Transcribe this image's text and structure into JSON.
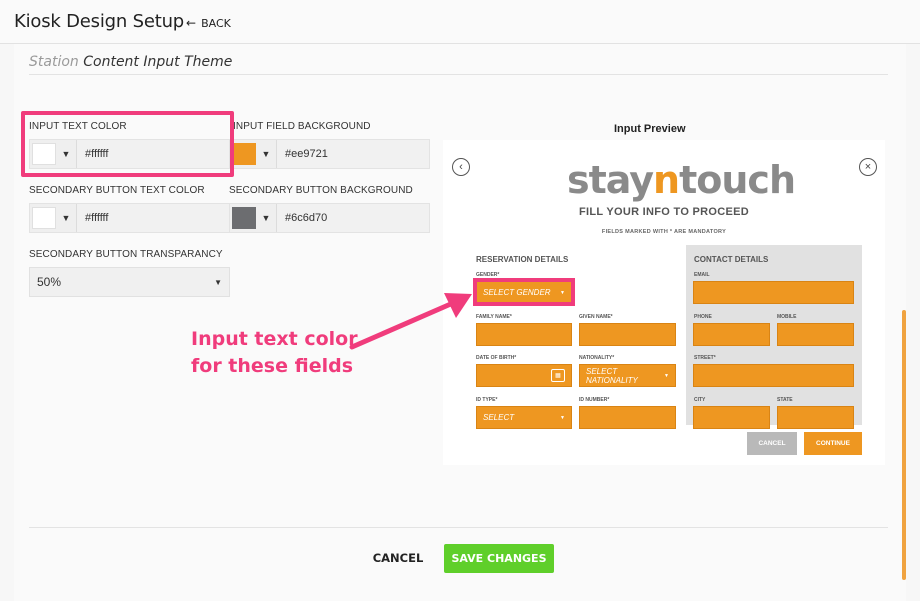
{
  "header": {
    "title": "Kiosk Design Setup",
    "back_label": "BACK"
  },
  "section": {
    "title_prefix": "Station",
    "title_main": "Content Input Theme"
  },
  "fields": {
    "input_text_color": {
      "label": "INPUT TEXT COLOR",
      "value": "#ffffff",
      "swatch": "#ffffff"
    },
    "input_field_background": {
      "label": "INPUT FIELD BACKGROUND",
      "value": "#ee9721",
      "swatch": "#ee9721"
    },
    "secondary_button_text_color": {
      "label": "SECONDARY BUTTON TEXT COLOR",
      "value": "#ffffff",
      "swatch": "#ffffff"
    },
    "secondary_button_background": {
      "label": "SECONDARY BUTTON BACKGROUND",
      "value": "#6c6d70",
      "swatch": "#6c6d70"
    },
    "secondary_button_transparency": {
      "label": "SECONDARY BUTTON TRANSPARANCY",
      "value": "50%"
    }
  },
  "preview": {
    "title": "Input Preview",
    "logo_a": "stay",
    "logo_n": "n",
    "logo_b": "touch",
    "heading": "FILL YOUR INFO TO PROCEED",
    "mandatory_note": "FIELDS MARKED WITH * ARE MANDATORY",
    "reservation": {
      "heading": "RESERVATION DETAILS",
      "gender_label": "GENDER*",
      "gender_value": "SELECT GENDER",
      "family_name_label": "FAMILY NAME*",
      "given_name_label": "GIVEN NAME*",
      "dob_label": "DATE OF BIRTH*",
      "nationality_label": "NATIONALITY*",
      "nationality_value": "SELECT NATIONALITY",
      "id_type_label": "ID TYPE*",
      "id_type_value": "SELECT",
      "id_number_label": "ID NUMBER*"
    },
    "contact": {
      "heading": "CONTACT DETAILS",
      "email_label": "EMAIL",
      "phone_label": "PHONE",
      "mobile_label": "MOBILE",
      "street_label": "STREET*",
      "city_label": "CITY",
      "state_label": "STATE"
    },
    "cancel_label": "CANCEL",
    "continue_label": "CONTINUE",
    "back_icon": "chevron-left-icon",
    "close_icon": "close-icon",
    "accent": "#ee9721",
    "secondary_button_color": "#b9b9b9"
  },
  "annotation": {
    "line1": "Input text color",
    "line2": "for these fields",
    "color": "#f03c7c"
  },
  "footer": {
    "cancel_label": "CANCEL",
    "save_label": "SAVE CHANGES",
    "save_color": "#5fcf2a"
  }
}
